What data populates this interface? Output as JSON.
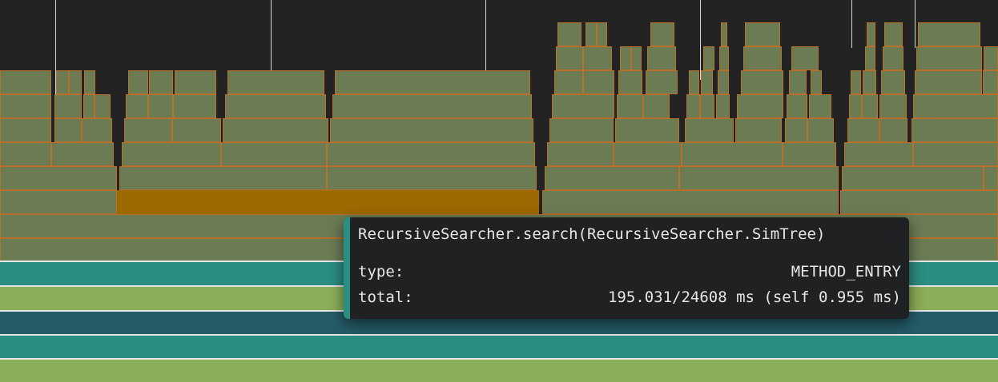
{
  "colors": {
    "background": "#232323",
    "frame": "#6b7c55",
    "frame_border": "#b8702a",
    "selected": "#9c6a00",
    "band_teal": "#2b8e82",
    "band_green": "#8bae58",
    "band_dark_teal": "#255c68",
    "tooltip_bg": "#202122",
    "tooltip_accent": "#2b8e82"
  },
  "tooltip": {
    "title": "RecursiveSearcher.search(RecursiveSearcher.SimTree)",
    "type_label": "type:",
    "type_value": "METHOD_ENTRY",
    "total_label": "total:",
    "total_value": "195.031/24608 ms (self 0.955 ms)"
  }
}
